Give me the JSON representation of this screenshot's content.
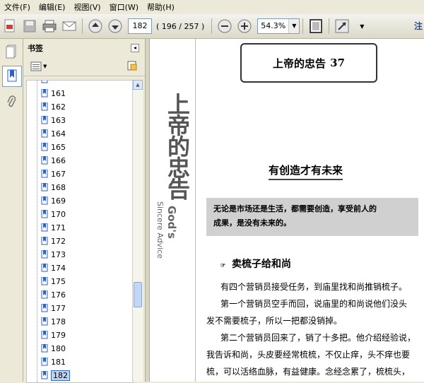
{
  "menu": {
    "items": [
      "文件(F)",
      "编辑(E)",
      "视图(V)",
      "窗口(W)",
      "帮助(H)"
    ]
  },
  "toolbar": {
    "page_number": "182",
    "page_of": "( 196 / 257 )",
    "zoom": "54.3%",
    "note_label": "注"
  },
  "bookmarks": {
    "title": "书签",
    "items": [
      "161",
      "162",
      "163",
      "164",
      "165",
      "166",
      "167",
      "168",
      "169",
      "170",
      "171",
      "172",
      "173",
      "174",
      "175",
      "176",
      "177",
      "178",
      "179",
      "180",
      "181",
      "182"
    ],
    "selected": "182"
  },
  "document": {
    "side_title": "上帝的忠告",
    "side_english": "God's",
    "side_english2": "Sincere Advice",
    "chapter_banner_text": "上帝的忠告",
    "chapter_number": "37",
    "heading": "有创造才有未来",
    "quote_line1": "无论是市场还是生活，都需要创造，享受前人的",
    "quote_line2": "成果，是没有未来的。",
    "sub_heading": "卖梳子给和尚",
    "paragraphs": [
      "有四个营销员接受任务，到庙里找和尚推销梳子。",
      "第一个营销员空手而回，说庙里的和尚说他们没头",
      "发不需要梳子，所以一把都没销掉。",
      "第二个营销员回来了，销了十多把。他介绍经验说，",
      "我告诉和尚，头皮要经常梳梳，不仅止痒，头不痒也要",
      "梳，可以活络血脉，有益健康。念经念累了，梳梳头，"
    ]
  }
}
